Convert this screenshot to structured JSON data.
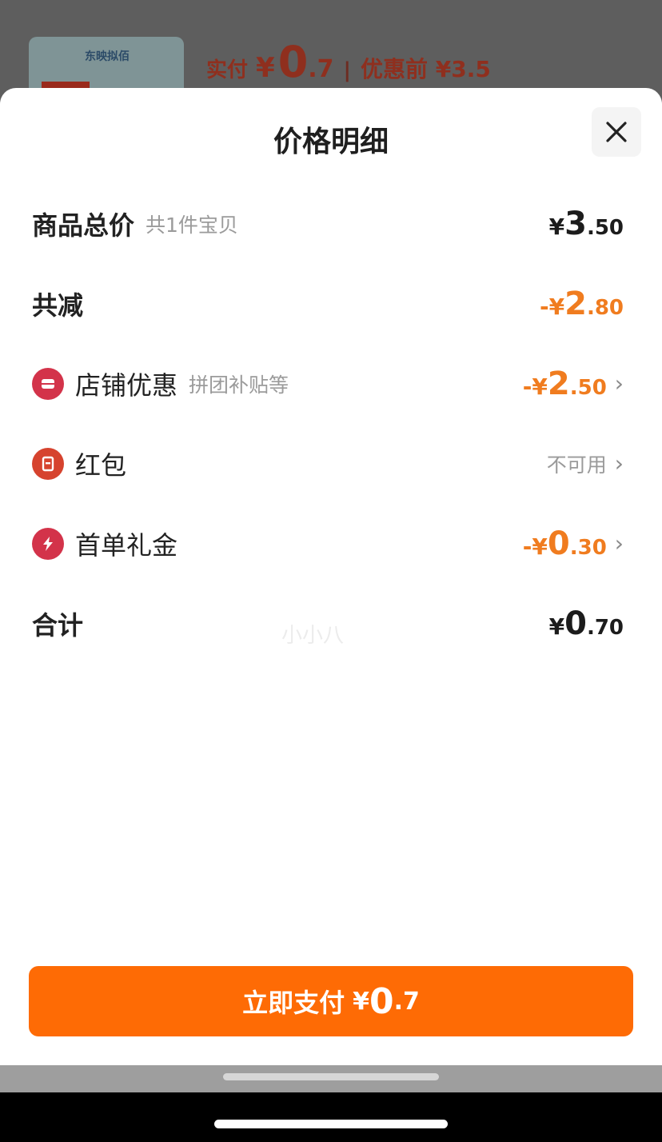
{
  "background": {
    "thumb_label": "东映拟佰",
    "actual_label": "实付",
    "actual_yen": "¥",
    "actual_int": "0",
    "actual_dec": ".7",
    "separator": "|",
    "original_label": "优惠前 ¥3.5"
  },
  "sheet": {
    "title": "价格明细",
    "close_icon": "close-icon"
  },
  "rows": {
    "total": {
      "label": "商品总价",
      "sub": "共1件宝贝",
      "yen": "¥",
      "int": "3",
      "dec": ".50"
    },
    "reduce": {
      "label": "共减",
      "yen": "-¥",
      "int": "2",
      "dec": ".80"
    },
    "store": {
      "label": "店铺优惠",
      "sub": "拼团补贴等",
      "yen": "-¥",
      "int": "2",
      "dec": ".50",
      "icon": "store-coupon-icon"
    },
    "redpacket": {
      "label": "红包",
      "status": "不可用",
      "icon": "red-packet-icon"
    },
    "first_order": {
      "label": "首单礼金",
      "yen": "-¥",
      "int": "0",
      "dec": ".30",
      "icon": "lightning-icon"
    },
    "sum": {
      "label": "合计",
      "yen": "¥",
      "int": "0",
      "dec": ".70"
    }
  },
  "watermark": "小小八",
  "pay": {
    "label": "立即支付",
    "yen": "¥",
    "int": "0",
    "dec": ".7"
  },
  "colors": {
    "accent": "#fe6b05",
    "discount": "#f07c1f",
    "icon_red": "#d3334a"
  }
}
